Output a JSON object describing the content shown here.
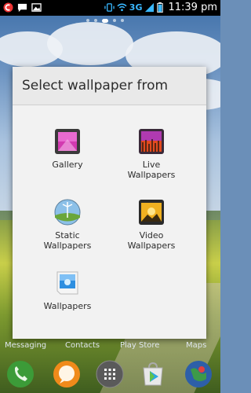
{
  "status": {
    "network": "3G",
    "time": "11:39 pm"
  },
  "dialog": {
    "title": "Select wallpaper from",
    "options": [
      {
        "label": "Gallery"
      },
      {
        "label": "Live\nWallpapers"
      },
      {
        "label": "Static\nWallpapers"
      },
      {
        "label": "Video\nWallpapers"
      },
      {
        "label": "Wallpapers"
      }
    ]
  },
  "dock": {
    "labels": [
      "Messaging",
      "Contacts",
      "Play Store",
      "Maps"
    ]
  },
  "colors": {
    "accent": "#39b8ff",
    "dialog_bg": "#f2f2f2"
  }
}
